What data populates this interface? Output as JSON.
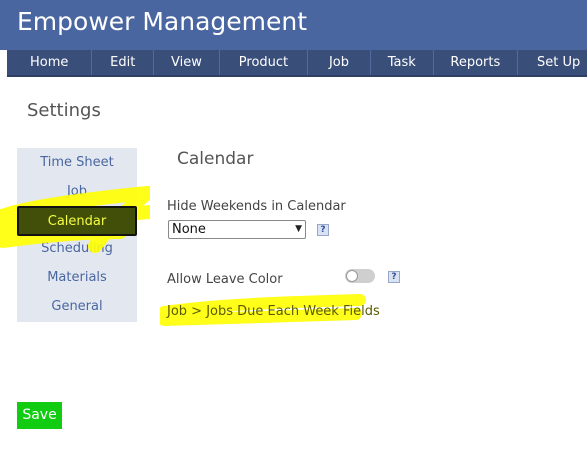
{
  "app": {
    "title": "Empower Management"
  },
  "nav": {
    "items": [
      {
        "label": "Home"
      },
      {
        "label": "Edit"
      },
      {
        "label": "View"
      },
      {
        "label": "Product"
      },
      {
        "label": "Job"
      },
      {
        "label": "Task"
      },
      {
        "label": "Reports"
      },
      {
        "label": "Set Up"
      }
    ]
  },
  "page": {
    "title": "Settings"
  },
  "sidebar": {
    "items": [
      {
        "label": "Time Sheet"
      },
      {
        "label": "Job"
      },
      {
        "label": "Calendar",
        "active": true
      },
      {
        "label": "Scheduling"
      },
      {
        "label": "Materials"
      },
      {
        "label": "General"
      }
    ]
  },
  "calendar": {
    "title": "Calendar",
    "hide_weekends_label": "Hide Weekends in Calendar",
    "hide_weekends_value": "None",
    "allow_leave_color_label": "Allow Leave Color",
    "allow_leave_color_on": false,
    "job_link": "Job > Jobs Due Each Week Fields"
  },
  "help_icon_glyph": "?",
  "save_label": "Save",
  "colors": {
    "header": "#4a66a0",
    "navbar": "#3a4e7a",
    "sidebar_bg": "#e3e8f0",
    "link": "#4a66a0",
    "save": "#11cc11",
    "highlight": "#ffff00"
  }
}
